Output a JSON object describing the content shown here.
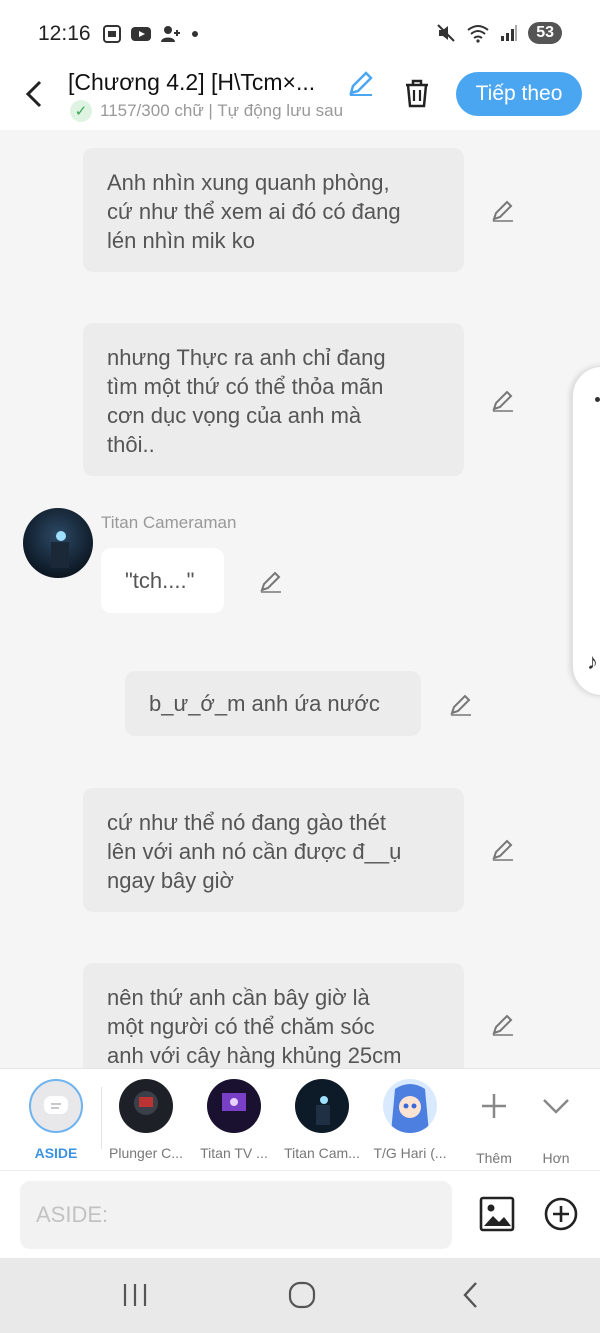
{
  "status_bar": {
    "time": "12:16",
    "battery": "53"
  },
  "header": {
    "title": "[Chương 4.2] [H\\Tcm×...",
    "subtitle": "1157/300 chữ | Tự động lưu sau",
    "next_button": "Tiếp theo"
  },
  "messages": {
    "m1": [
      "Anh nhìn xung quanh phòng,",
      "cứ như thể xem ai đó có đang",
      "lén nhìn mik ko"
    ],
    "m2": [
      "nhưng Thực ra anh chỉ đang",
      "tìm một thứ có thể thỏa mãn",
      "cơn dục vọng của anh mà",
      "thôi.."
    ],
    "m3_speaker": "Titan Cameraman",
    "m3": "\"tch....\"",
    "m4": "b_ư_ớ_m anh ứa nước",
    "m5": [
      "cứ như thể nó đang gào thét",
      "lên với anh nó cần được đ__ụ",
      "ngay bây giờ"
    ],
    "m6": [
      "nên thứ anh cần bây giờ là",
      "một người có thể chăm sóc",
      "anh với cây hàng khủng 25cm"
    ]
  },
  "characters": [
    {
      "label": "ASIDE"
    },
    {
      "label": "Plunger C..."
    },
    {
      "label": "Titan TV ..."
    },
    {
      "label": "Titan Cam..."
    },
    {
      "label": "T/G Hari (..."
    }
  ],
  "more_label": "Thêm",
  "less_label": "Hơn",
  "input": {
    "placeholder": "ASIDE:"
  },
  "colors": {
    "accent": "#4ba6f2",
    "bubble": "#ececec",
    "background": "#f5f5f5"
  }
}
